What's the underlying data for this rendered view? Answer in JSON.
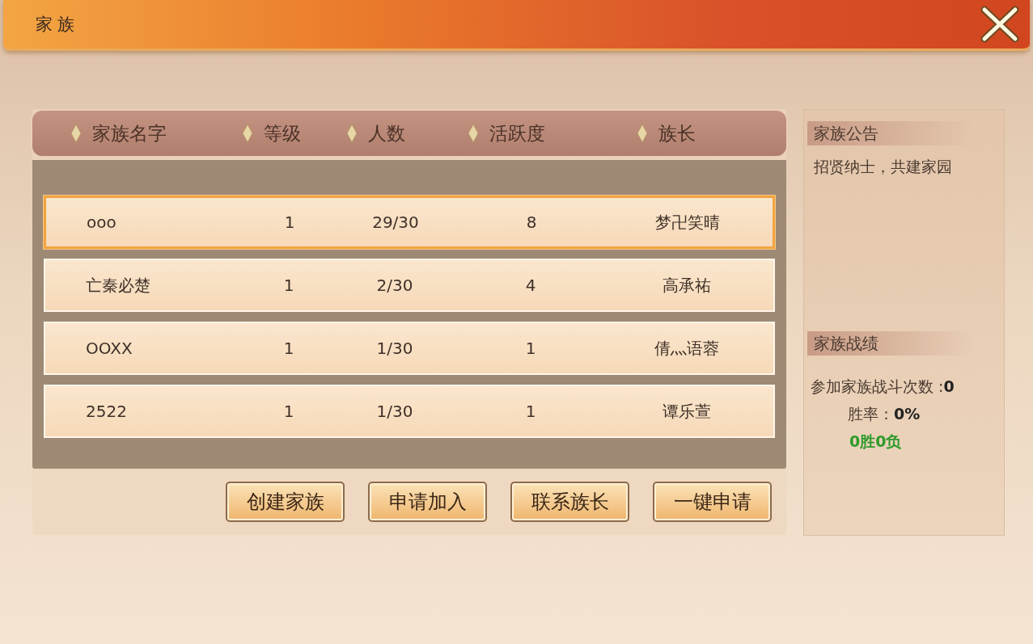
{
  "window": {
    "title": "家族"
  },
  "table": {
    "columns": [
      "家族名字",
      "等级",
      "人数",
      "活跃度",
      "族长"
    ],
    "rows": [
      {
        "cells": [
          "ooo",
          "1",
          "29/30",
          "8",
          "梦卍笑晴"
        ],
        "selected": true
      },
      {
        "cells": [
          "亡秦必楚",
          "1",
          "2/30",
          "4",
          "高承祐"
        ],
        "selected": false
      },
      {
        "cells": [
          "OOXX",
          "1",
          "1/30",
          "1",
          "倩灬语蓉"
        ],
        "selected": false
      },
      {
        "cells": [
          "2522",
          "1",
          "1/30",
          "1",
          "谭乐萱"
        ],
        "selected": false
      }
    ]
  },
  "buttons": [
    "创建家族",
    "申请加入",
    "联系族长",
    "一键申请"
  ],
  "notice": {
    "heading": "家族公告",
    "text": "招贤纳士，共建家园"
  },
  "record": {
    "heading": "家族战绩",
    "battles": "参加家族战斗次数 :**0**",
    "win_rate": "胜率：**0%**",
    "result": "0胜0负"
  }
}
